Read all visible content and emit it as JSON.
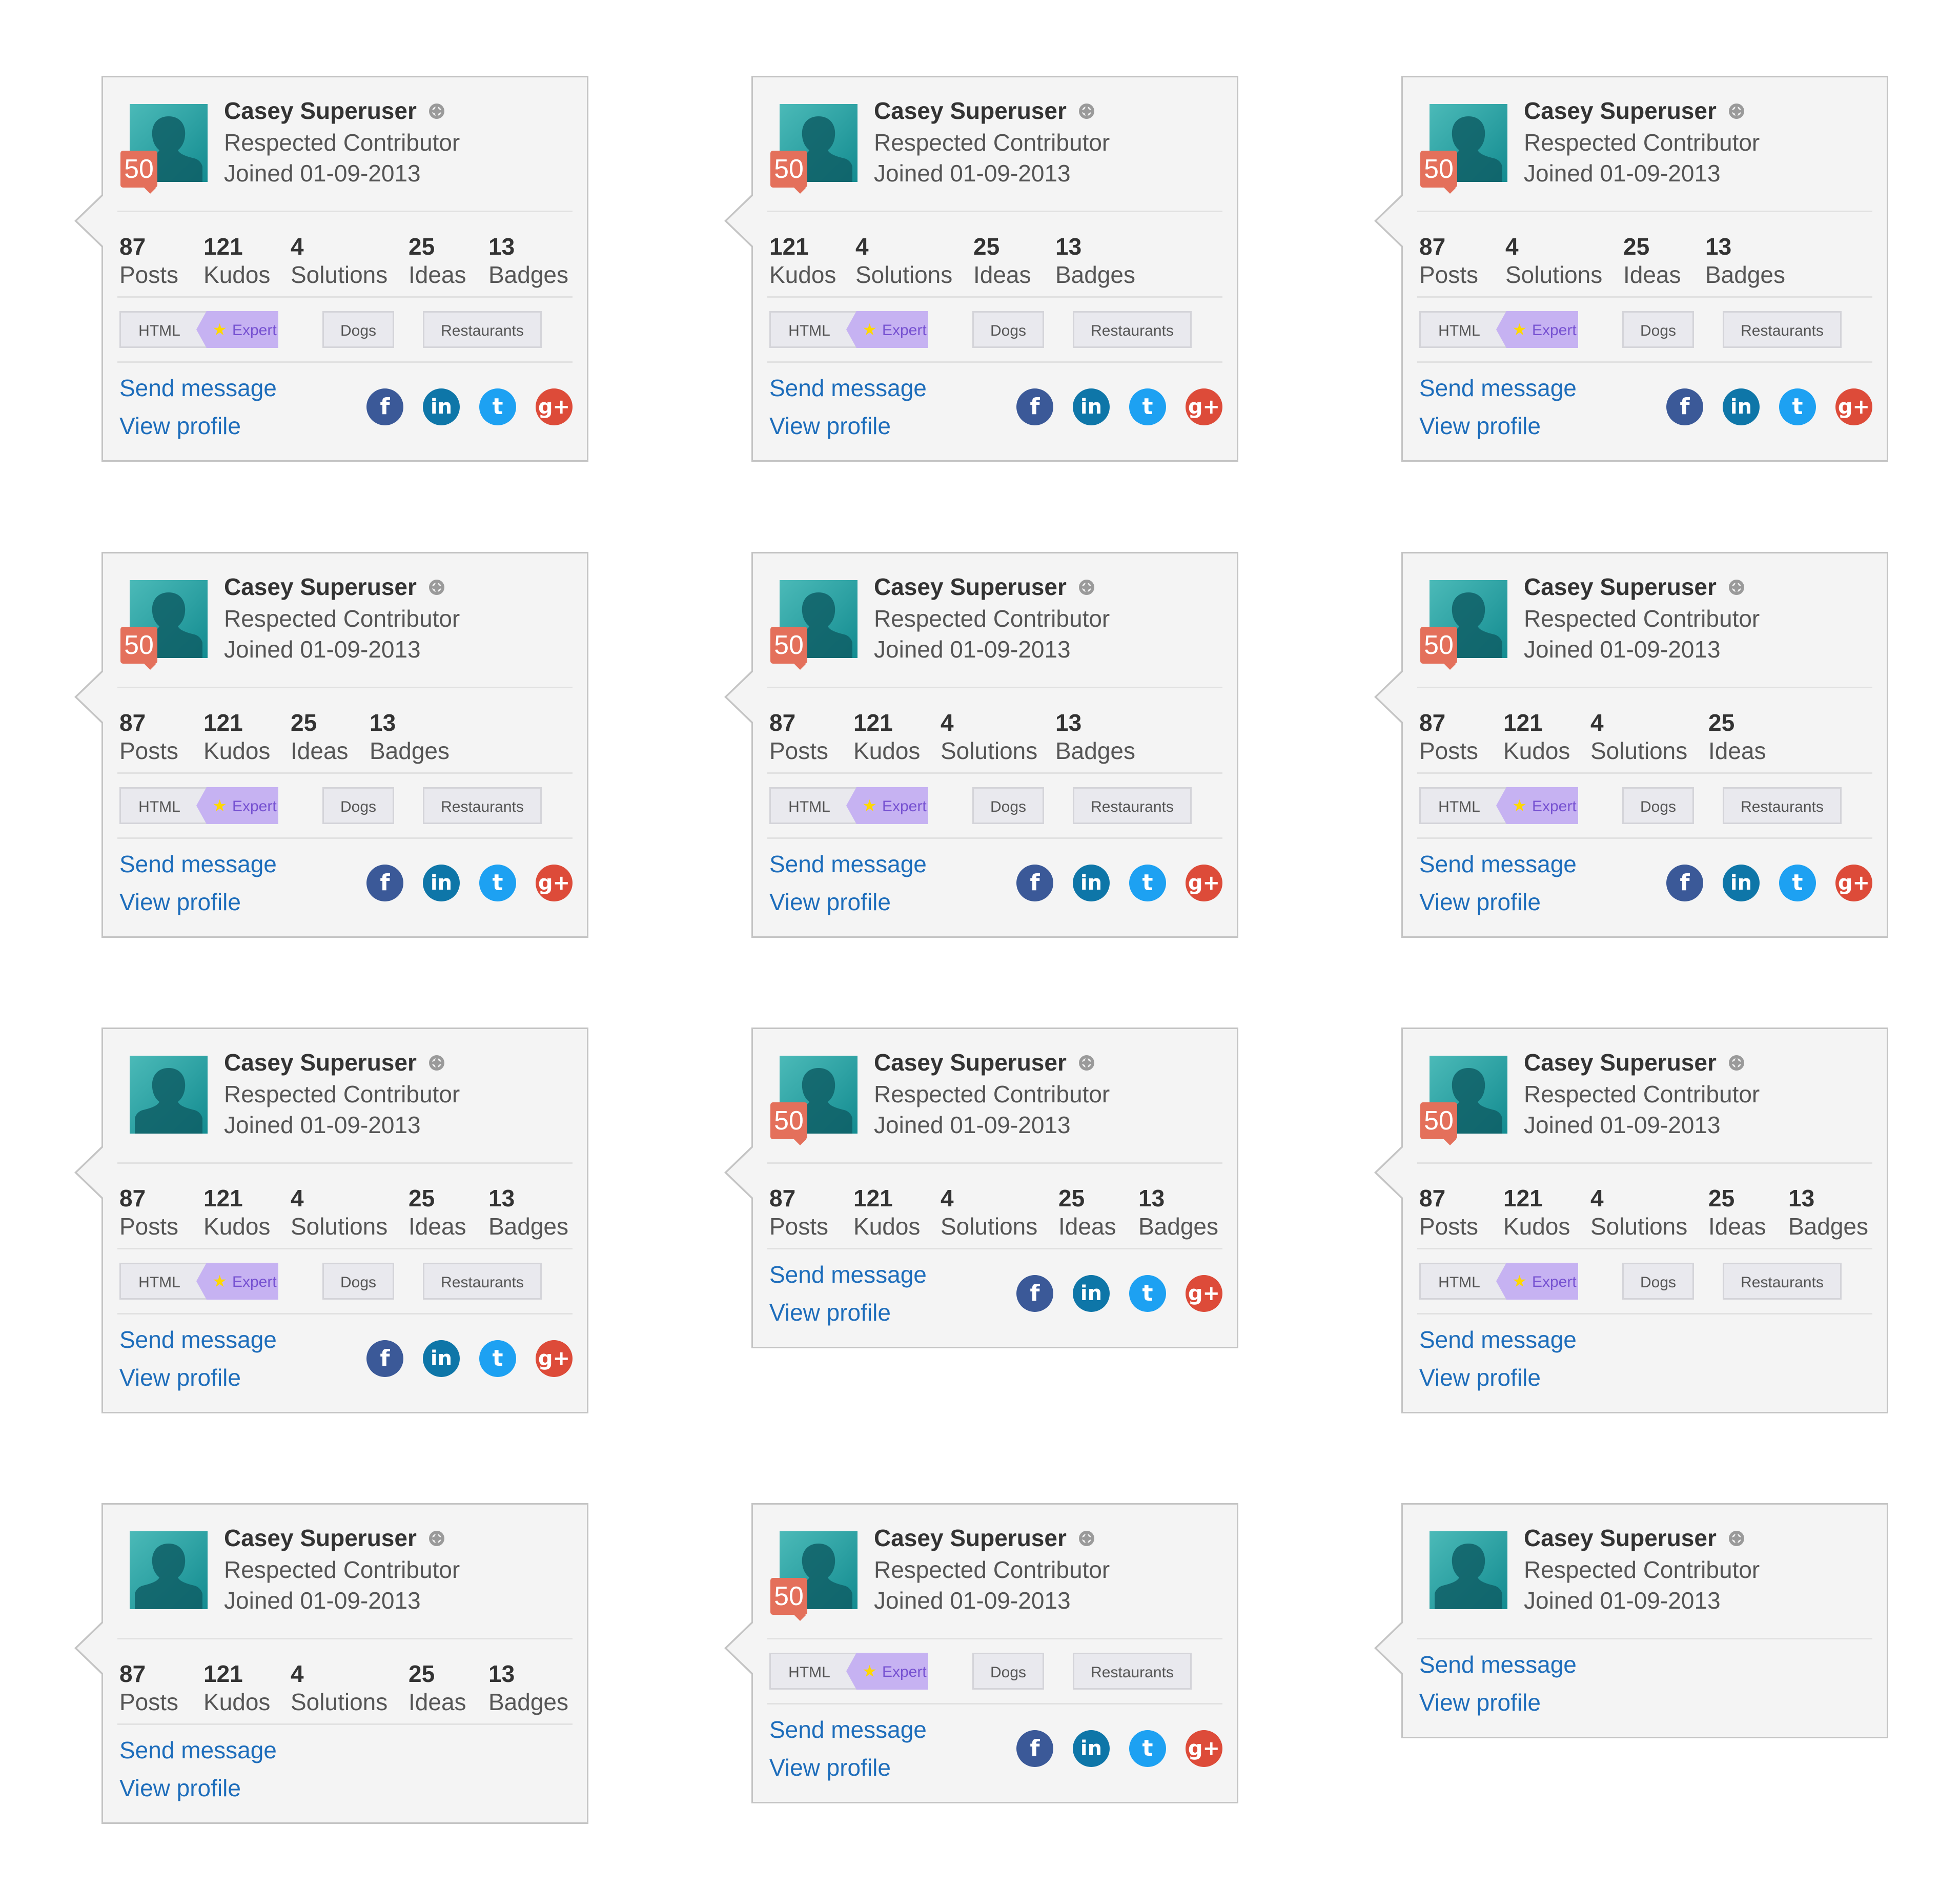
{
  "user": {
    "name": "Casey Superuser",
    "role": "Respected Contributor",
    "joined": "Joined 01-09-2013",
    "rank_badge": "50",
    "rank_icon": "gear-rank-icon"
  },
  "stats": {
    "posts": {
      "value": "87",
      "label": "Posts"
    },
    "kudos": {
      "value": "121",
      "label": "Kudos"
    },
    "solutions": {
      "value": "4",
      "label": "Solutions"
    },
    "ideas": {
      "value": "25",
      "label": "Ideas"
    },
    "badges": {
      "value": "13",
      "label": "Badges"
    }
  },
  "tags": {
    "html": "HTML",
    "expert_star": "★",
    "expert": "Expert",
    "dogs": "Dogs",
    "restaurants": "Restaurants"
  },
  "links": {
    "send_message": "Send message",
    "view_profile": "View profile"
  },
  "social": {
    "facebook": "f",
    "linkedin": "in",
    "twitter": "t",
    "googleplus": "g+"
  },
  "colors": {
    "accent": "#1d6dbb",
    "rank_badge": "#e4705b",
    "expert_tag": "#c6b2f2",
    "facebook": "#3b5998",
    "linkedin": "#0e76a8",
    "twitter": "#1da1f2",
    "googleplus": "#dd4b39"
  },
  "cards": [
    {
      "rank": true,
      "stats": [
        "posts",
        "kudos",
        "solutions",
        "ideas",
        "badges"
      ],
      "tags": true,
      "social": true
    },
    {
      "rank": true,
      "stats": [
        "kudos",
        "solutions",
        "ideas",
        "badges"
      ],
      "tags": true,
      "social": true
    },
    {
      "rank": true,
      "stats": [
        "posts",
        "solutions",
        "ideas",
        "badges"
      ],
      "tags": true,
      "social": true
    },
    {
      "rank": true,
      "stats": [
        "posts",
        "kudos",
        "ideas",
        "badges"
      ],
      "tags": true,
      "social": true
    },
    {
      "rank": true,
      "stats": [
        "posts",
        "kudos",
        "solutions",
        "badges"
      ],
      "tags": true,
      "social": true
    },
    {
      "rank": true,
      "stats": [
        "posts",
        "kudos",
        "solutions",
        "ideas"
      ],
      "tags": true,
      "social": true
    },
    {
      "rank": false,
      "stats": [
        "posts",
        "kudos",
        "solutions",
        "ideas",
        "badges"
      ],
      "tags": true,
      "social": true
    },
    {
      "rank": true,
      "stats": [
        "posts",
        "kudos",
        "solutions",
        "ideas",
        "badges"
      ],
      "tags": false,
      "social": true
    },
    {
      "rank": true,
      "stats": [
        "posts",
        "kudos",
        "solutions",
        "ideas",
        "badges"
      ],
      "tags": true,
      "social": false
    },
    {
      "rank": false,
      "stats": [
        "posts",
        "kudos",
        "solutions",
        "ideas",
        "badges"
      ],
      "tags": false,
      "social": false
    },
    {
      "rank": true,
      "stats": [],
      "tags": true,
      "social": true
    },
    {
      "rank": false,
      "stats": [],
      "tags": false,
      "social": false
    }
  ]
}
